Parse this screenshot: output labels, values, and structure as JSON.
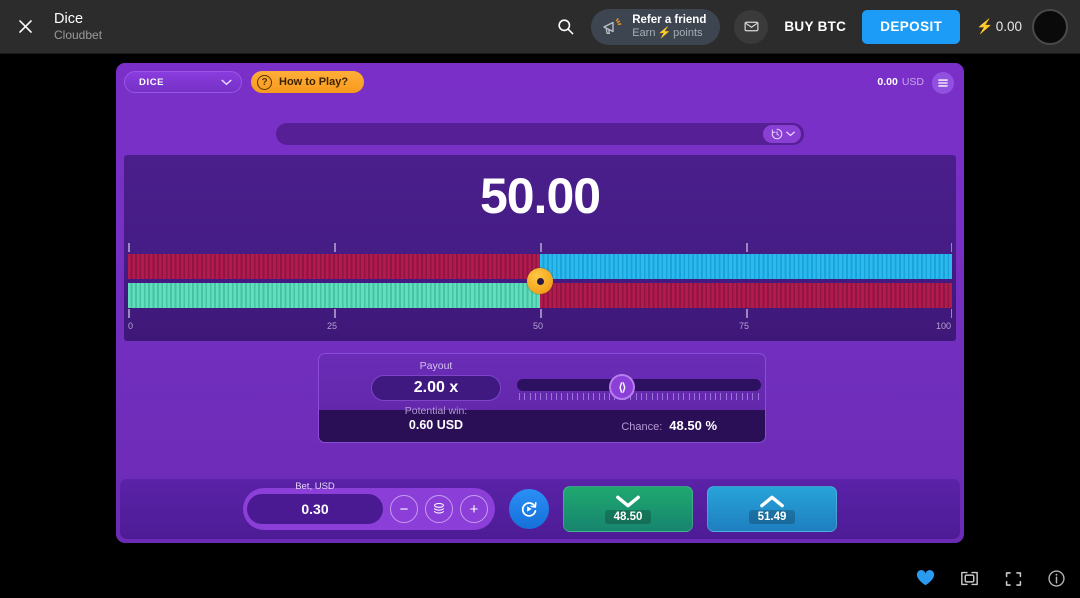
{
  "topbar": {
    "close_icon": "close-icon",
    "title": "Dice",
    "subtitle": "Cloudbet",
    "search_icon": "search-icon",
    "refer": {
      "line1": "Refer a friend",
      "line2_prefix": "Earn",
      "line2_bolt": "⚡",
      "line2_suffix": "points",
      "icon": "megaphone-icon"
    },
    "mail_icon": "envelope-icon",
    "buy_btc_label": "BUY BTC",
    "deposit_label": "DEPOSIT",
    "balance_bolt": "⚡",
    "balance_amount": "0.00",
    "avatar": "avatar"
  },
  "game": {
    "selector_label": "DICE",
    "howto_label": "How to Play?",
    "howto_icon": "question-mark-icon",
    "balance_amount": "0.00",
    "balance_currency": "USD",
    "menu_icon": "hamburger-icon",
    "history_icon": "history-clock-icon",
    "history_chevron": "chevron-down-icon",
    "result_value": "50.00",
    "axis_labels": [
      "0",
      "25",
      "50",
      "75",
      "100"
    ],
    "axis_positions": [
      0,
      25,
      50,
      75,
      100
    ],
    "slider_value": 50,
    "bars": {
      "upper_left_color": "#b31a4f",
      "upper_right_color": "#2bbaf0",
      "lower_left_color": "#62ddbd",
      "lower_right_color": "#b31a4f",
      "handle_color": "#f2a31c"
    },
    "payout": {
      "label": "Payout",
      "value": "2.00 x",
      "slider_position_pct": 43,
      "knob_icon": "left-right-arrows-icon",
      "potential_win_label": "Potential win:",
      "potential_win_value": "0.60 USD",
      "chance_label": "Chance:",
      "chance_value": "48.50 %"
    },
    "bet": {
      "label": "Bet, USD",
      "value": "0.30",
      "minus_label": "−",
      "plus_label": "+",
      "chips_icon": "coin-stack-icon",
      "auto_icon": "auto-play-icon",
      "roll_low": {
        "icon": "chevron-down-icon",
        "value": "48.50"
      },
      "roll_high": {
        "icon": "chevron-up-icon",
        "value": "51.49"
      }
    }
  },
  "footer": {
    "icons": [
      "heart-icon",
      "theater-mode-icon",
      "fullscreen-icon",
      "info-icon"
    ],
    "heart_color": "#2b9bf0"
  }
}
